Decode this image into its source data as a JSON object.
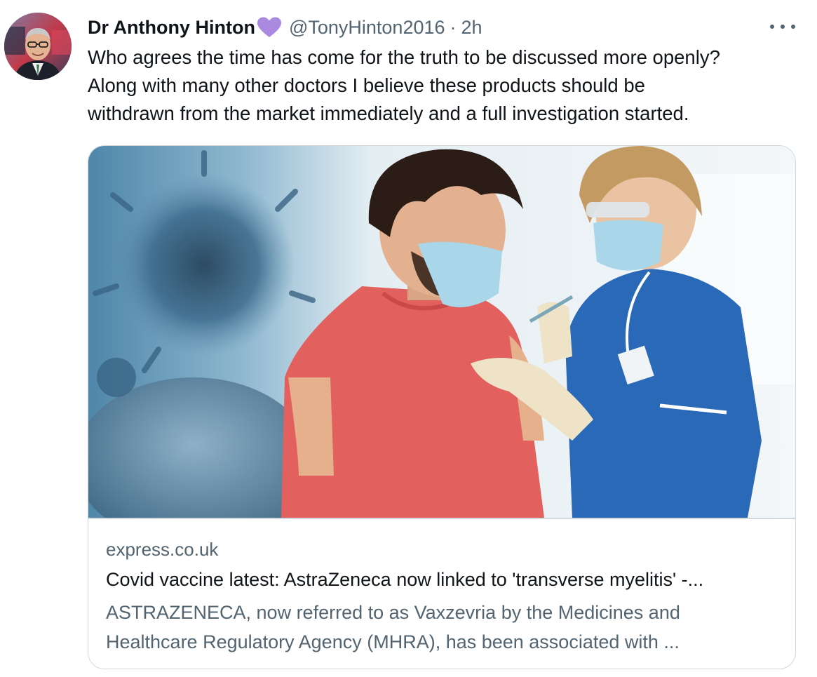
{
  "tweet": {
    "author_name": "Dr Anthony Hinton",
    "badge_icon": "purple-heart-icon",
    "handle": "@TonyHinton2016",
    "separator": "·",
    "time": "2h",
    "more_icon": "more-dots-icon",
    "text_lines": [
      "Who agrees the time has come for the truth to be discussed more openly?",
      "Along with many other doctors I believe these products should be",
      "withdrawn from the market immediately and a full investigation started."
    ]
  },
  "card": {
    "domain": "express.co.uk",
    "title": "Covid vaccine latest: AstraZeneca now linked to 'transverse myelitis' -...",
    "description_lines": [
      "ASTRAZENECA, now referred to as Vaxzevria by the Medicines and",
      "Healthcare Regulatory Agency (MHRA), has been associated with ..."
    ]
  },
  "colors": {
    "text_primary": "#0f1419",
    "text_secondary": "#536471",
    "border": "#cfd9de",
    "badge_purple": "#a98ae0"
  }
}
